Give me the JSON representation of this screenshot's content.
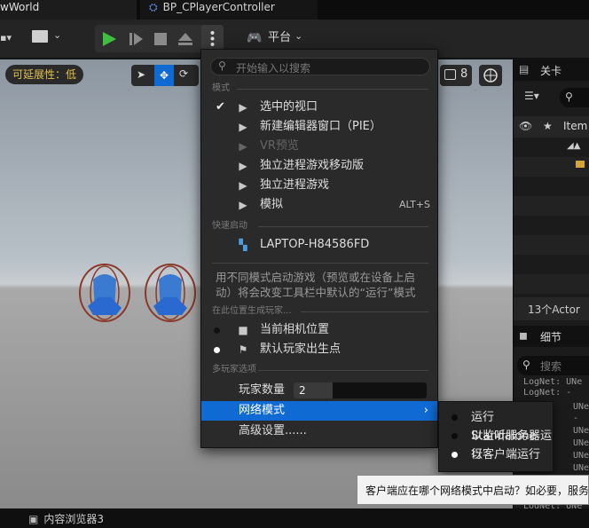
{
  "tabs": {
    "level_tab": "wWorld",
    "bp_tab": "BP_CPlayerController"
  },
  "toolbar": {
    "platform_label": "平台"
  },
  "viewport": {
    "scalability_badge": "可延展性：低",
    "camera_speed": "8"
  },
  "menu": {
    "search_placeholder": "开始输入以搜索",
    "section_mode": "模式",
    "items": {
      "selected_viewport": "选中的视口",
      "new_editor_window": "新建编辑器窗口（PIE）",
      "vr_preview": "VR预览",
      "standalone_mobile": "独立进程游戏移动版",
      "standalone_game": "独立进程游戏",
      "simulate": "模拟",
      "simulate_shortcut": "ALT+S"
    },
    "section_quick_launch": "快速启动",
    "device_name": "LAPTOP-H84586FD",
    "info_text_line1": "用不同模式启动游戏（预览或在设备上启",
    "info_text_line2": "动）将会改变工具栏中默认的“运行”模式",
    "section_spawn": "在此位置生成玩家...",
    "spawn": {
      "current_camera": "当前相机位置",
      "default_player_start": "默认玩家出生点"
    },
    "section_multiplayer": "多玩家选项",
    "player_count_label": "玩家数量",
    "player_count_value": "2",
    "net_mode_label": "网络模式",
    "advanced_settings": "高级设置......"
  },
  "net_submenu": {
    "standalone": "运行Standalone",
    "listen_server": "以监听服务器运行",
    "client": "以客户端运行"
  },
  "tooltip": "客户端应在哪个网络模式中启动？如必要，服务",
  "outliner": {
    "tab_label": "关卡",
    "search_char": "搜",
    "column_item": "Item",
    "actor_count": "13个Actor"
  },
  "details": {
    "tab_label": "细节",
    "search_placeholder": "搜索"
  },
  "logs": [
    "LogNet: UNe",
    "LogNet: -",
    "UNe",
    "-",
    "UNe",
    "UNe",
    "UNe",
    "UNe",
    "UNe",
    "-",
    "LogNet: UNe",
    "LogNet: UNe"
  ],
  "bottom": {
    "content_browser": "内容浏览器3"
  },
  "colors": {
    "accent_blue": "#0f6ad4",
    "play_green": "#3fbf3f",
    "badge_yellow": "#e3c04a",
    "menu_bg": "#2a2a2a"
  }
}
